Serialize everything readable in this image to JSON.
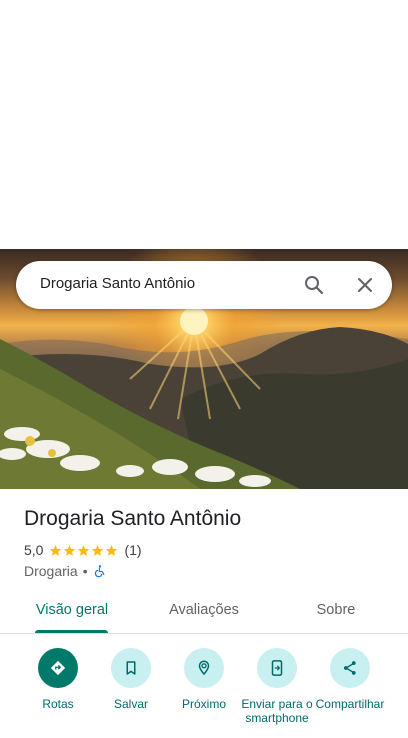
{
  "search": {
    "query": "Drogaria Santo Antônio"
  },
  "place": {
    "title": "Drogaria Santo Antônio",
    "rating": "5,0",
    "stars": 5,
    "review_count": "(1)",
    "category": "Drogaria",
    "separator": "•"
  },
  "tabs": [
    {
      "label": "Visão geral",
      "active": true
    },
    {
      "label": "Avaliações",
      "active": false
    },
    {
      "label": "Sobre",
      "active": false
    }
  ],
  "actions": [
    {
      "label": "Rotas",
      "icon": "directions-icon"
    },
    {
      "label": "Salvar",
      "icon": "bookmark-icon"
    },
    {
      "label": "Próximo",
      "icon": "nearby-icon"
    },
    {
      "label": "Enviar para o smartphone",
      "icon": "send-to-phone-icon"
    },
    {
      "label": "Compartilhar",
      "icon": "share-icon"
    }
  ],
  "colors": {
    "accent": "#00796b",
    "action_bg": "#c9f0f0",
    "star": "#fbbc04"
  }
}
